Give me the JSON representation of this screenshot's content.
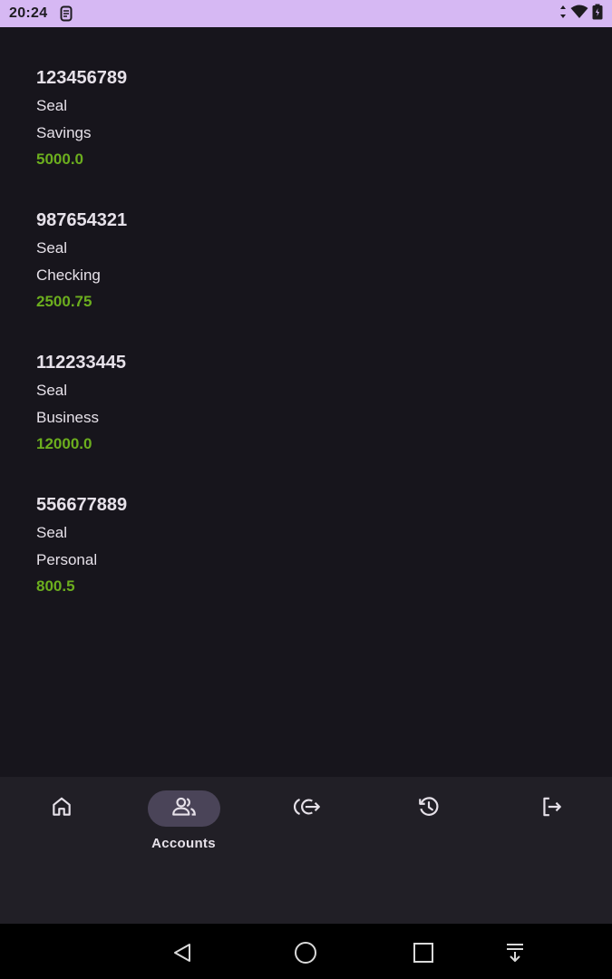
{
  "status_bar": {
    "time": "20:24",
    "icons": [
      "sim-icon",
      "data-arrows-icon",
      "wifi-icon",
      "battery-icon"
    ]
  },
  "accounts": [
    {
      "number": "123456789",
      "owner": "Seal",
      "type": "Savings",
      "balance": "5000.0"
    },
    {
      "number": "987654321",
      "owner": "Seal",
      "type": "Checking",
      "balance": "2500.75"
    },
    {
      "number": "112233445",
      "owner": "Seal",
      "type": "Business",
      "balance": "12000.0"
    },
    {
      "number": "556677889",
      "owner": "Seal",
      "type": "Personal",
      "balance": "800.5"
    }
  ],
  "bottom_nav": {
    "items": [
      {
        "icon": "home-icon",
        "label": "",
        "active": false
      },
      {
        "icon": "accounts-icon",
        "label": "Accounts",
        "active": true
      },
      {
        "icon": "transfer-icon",
        "label": "",
        "active": false
      },
      {
        "icon": "history-icon",
        "label": "",
        "active": false
      },
      {
        "icon": "logout-icon",
        "label": "",
        "active": false
      }
    ]
  },
  "system_nav": [
    "back-icon",
    "home-circle-icon",
    "recents-icon",
    "notifications-pull-icon"
  ],
  "colors": {
    "status_bar": "#d6b8f3",
    "background": "#17151c",
    "nav_background": "#211f26",
    "active_pill": "#4a4458",
    "balance": "#6cae1e",
    "text": "#e6e1e9"
  }
}
